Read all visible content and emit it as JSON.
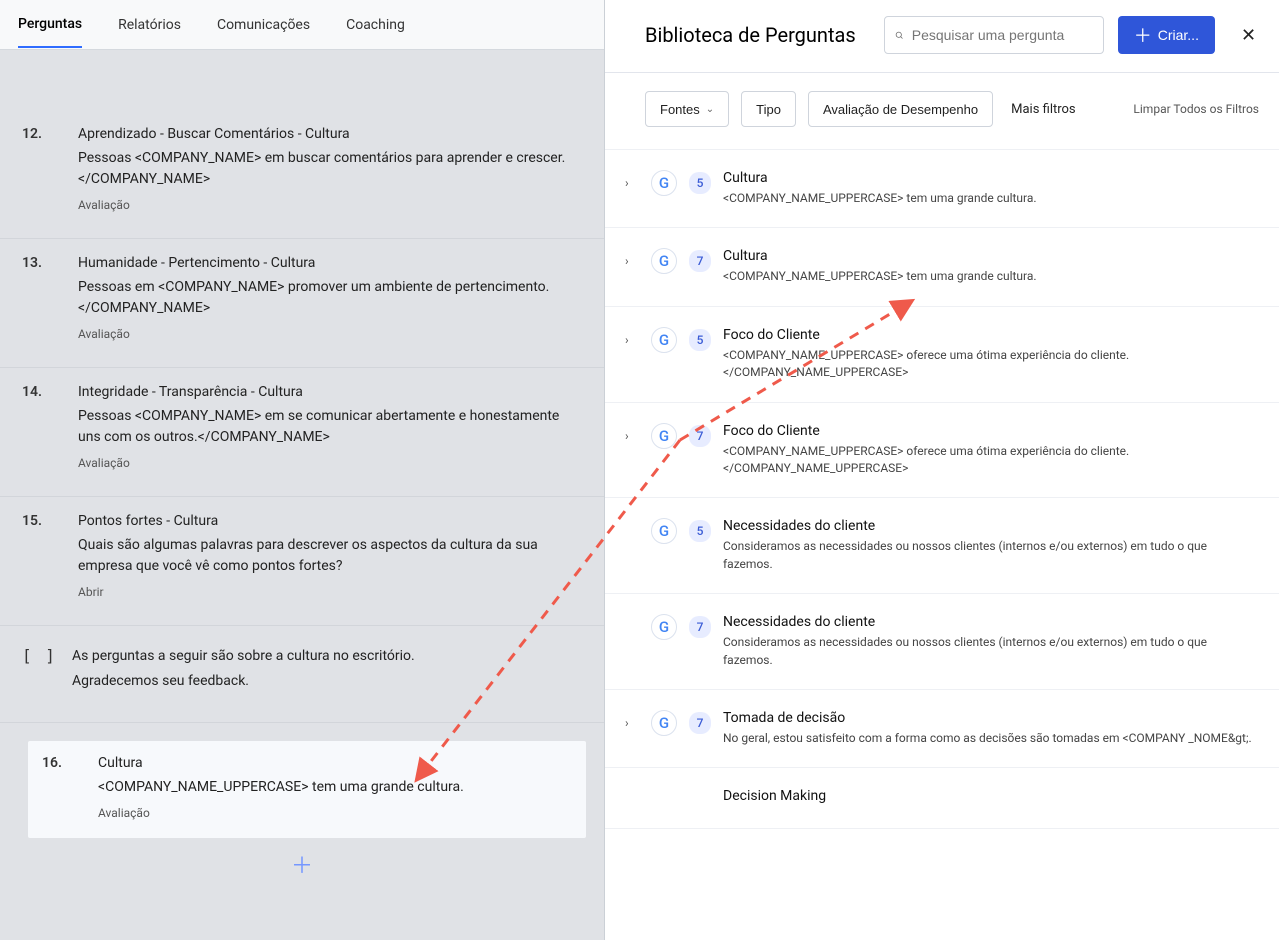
{
  "tabs": {
    "perguntas": "Perguntas",
    "relatorios": "Relatórios",
    "comunicacoes": "Comunicações",
    "coaching": "Coaching"
  },
  "questions": [
    {
      "num": "12.",
      "title": "Aprendizado - Buscar Comentários - Cultura",
      "text": "Pessoas <COMPANY_NAME> em buscar comentários para aprender e crescer.</COMPANY_NAME>",
      "type": "Avaliação"
    },
    {
      "num": "13.",
      "title": "Humanidade - Pertencimento - Cultura",
      "text": "Pessoas em <COMPANY_NAME> promover um ambiente de pertencimento.</COMPANY_NAME>",
      "type": "Avaliação"
    },
    {
      "num": "14.",
      "title": "Integridade - Transparência - Cultura",
      "text": "Pessoas <COMPANY_NAME> em se comunicar abertamente e honestamente uns com os outros.</COMPANY_NAME>",
      "type": "Avaliação"
    },
    {
      "num": "15.",
      "title": "Pontos fortes - Cultura",
      "text": "Quais são algumas palavras para descrever os aspectos da cultura da sua empresa que você vê como pontos fortes?",
      "type": "Abrir"
    }
  ],
  "section_note": {
    "line1": "As perguntas a seguir são sobre a cultura no escritório.",
    "line2": "Agradecemos seu feedback."
  },
  "highlighted_question": {
    "num": "16.",
    "title": "Cultura",
    "text_prefix": "<COMPANY_NAME_UPPERCASE>",
    "text_suffix": " tem uma grande cultura.",
    "type": "Avaliação"
  },
  "rp": {
    "title": "Biblioteca de Perguntas",
    "search_placeholder": "Pesquisar uma pergunta",
    "create_label": "Criar...",
    "filters": {
      "fontes": "Fontes",
      "tipo": "Tipo",
      "avaliacao": "Avaliação de Desempenho",
      "mais": "Mais filtros",
      "limpar": "Limpar Todos os Filtros"
    }
  },
  "library": [
    {
      "expand": true,
      "g": true,
      "badge": "5",
      "title": "Cultura",
      "text": "<COMPANY_NAME_UPPERCASE>  tem uma grande cultura."
    },
    {
      "expand": true,
      "g": true,
      "badge": "7",
      "title": "Cultura",
      "text": "<COMPANY_NAME_UPPERCASE>  tem uma grande cultura."
    },
    {
      "expand": true,
      "g": true,
      "badge": "5",
      "title": "Foco do Cliente",
      "text": "<COMPANY_NAME_UPPERCASE> oferece uma ótima experiência do cliente.</COMPANY_NAME_UPPERCASE>"
    },
    {
      "expand": true,
      "g": true,
      "badge": "7",
      "title": "Foco do Cliente",
      "text": "<COMPANY_NAME_UPPERCASE> oferece uma ótima experiência do cliente.</COMPANY_NAME_UPPERCASE>"
    },
    {
      "expand": false,
      "g": true,
      "badge": "5",
      "title": "Necessidades do cliente",
      "text": "Consideramos as necessidades ou nossos clientes (internos e/ou externos) em tudo o que fazemos."
    },
    {
      "expand": false,
      "g": true,
      "badge": "7",
      "title": "Necessidades do cliente",
      "text": "Consideramos as necessidades ou nossos clientes (internos e/ou externos) em tudo o que fazemos."
    },
    {
      "expand": true,
      "g": true,
      "badge": "7",
      "title": "Tomada de decisão",
      "text": "No geral, estou satisfeito com a forma como as decisões são tomadas em <COMPANY    _NOME&gt;."
    },
    {
      "expand": false,
      "g": false,
      "badge": "",
      "title": "Decision Making",
      "text": ""
    }
  ],
  "glyphs": {
    "g_letter": "G",
    "chevron_right": "›",
    "chevron_down": "⌄",
    "close_x": "✕",
    "plus": "＋",
    "brackets": "[ ]"
  }
}
